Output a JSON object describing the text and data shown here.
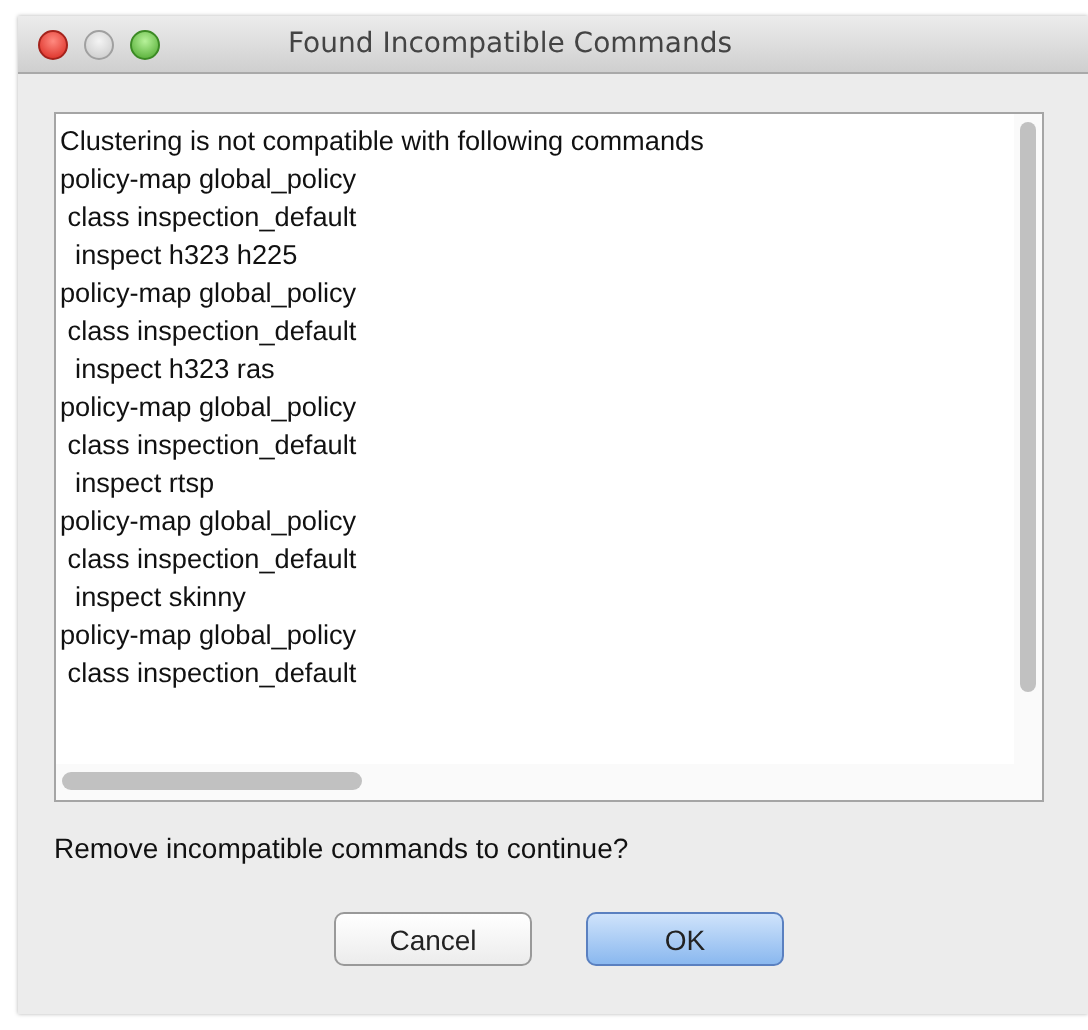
{
  "window": {
    "title": "Found Incompatible Commands"
  },
  "lines": [
    "Clustering is not compatible with following commands",
    "policy-map global_policy",
    " class inspection_default",
    "  inspect h323 h225",
    "policy-map global_policy",
    " class inspection_default",
    "  inspect h323 ras",
    "policy-map global_policy",
    " class inspection_default",
    "  inspect rtsp",
    "policy-map global_policy",
    " class inspection_default",
    "  inspect skinny",
    "policy-map global_policy",
    " class inspection_default"
  ],
  "question": "Remove incompatible commands to continue?",
  "buttons": [
    {
      "label": "Cancel",
      "kind": "normal"
    },
    {
      "label": "OK",
      "kind": "default"
    }
  ]
}
